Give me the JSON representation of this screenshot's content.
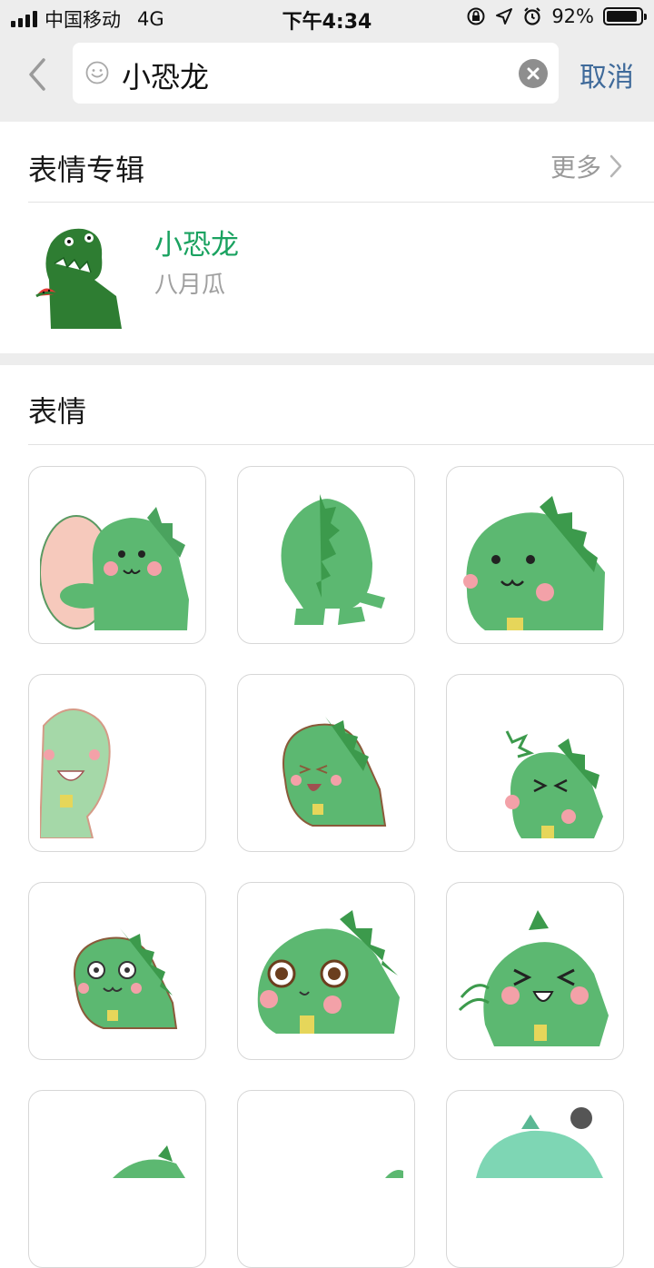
{
  "status_bar": {
    "carrier": "中国移动",
    "network": "4G",
    "time": "下午4:34",
    "battery_percent": "92%",
    "battery_level": 0.92
  },
  "search": {
    "query": "小恐龙",
    "cancel_label": "取消"
  },
  "album_section": {
    "title": "表情专辑",
    "more_label": "更多",
    "album": {
      "name": "小恐龙",
      "author": "八月瓜"
    }
  },
  "stickers_section": {
    "title": "表情"
  },
  "colors": {
    "accent_green": "#1aa260",
    "link_blue": "#3f6a9a",
    "dino_green": "#5cb871",
    "dark_dino": "#2e7d32"
  }
}
